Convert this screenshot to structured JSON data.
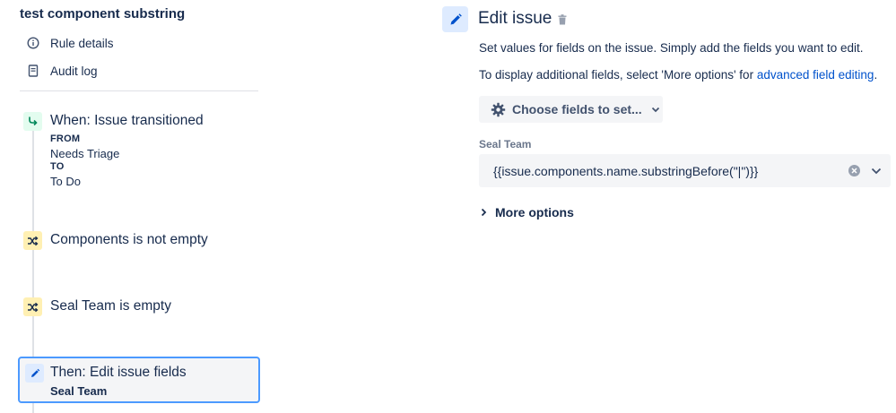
{
  "rule": {
    "title": "test component substring"
  },
  "nav": {
    "items": [
      {
        "label": "Rule details",
        "icon": "info-icon"
      },
      {
        "label": "Audit log",
        "icon": "document-icon"
      }
    ]
  },
  "steps": {
    "trigger": {
      "label": "When: Issue transitioned",
      "from_key": "FROM",
      "from_value": "Needs Triage",
      "to_key": "TO",
      "to_value": "To Do",
      "icon": "transition-icon"
    },
    "condition1": {
      "label": "Components is not empty",
      "icon": "shuffle-icon"
    },
    "condition2": {
      "label": "Seal Team is empty",
      "icon": "shuffle-icon"
    },
    "action": {
      "label": "Then: Edit issue fields",
      "sub": "Seal Team",
      "icon": "pencil-icon"
    }
  },
  "editor": {
    "title": "Edit issue",
    "description1": "Set values for fields on the issue. Simply add the fields you want to edit.",
    "description2_prefix": "To display additional fields, select 'More options' for ",
    "description2_link": "advanced field editing",
    "description2_suffix": ".",
    "choose_fields_label": "Choose fields to set...",
    "field": {
      "label": "Seal Team",
      "value": "{{issue.components.name.substringBefore(\"|\")}}"
    },
    "more_options_label": "More options"
  },
  "colors": {
    "accent": "#0052cc",
    "trigger_badge": "#e3fcef",
    "condition_badge": "#fff0b3",
    "action_badge": "#deebff",
    "selected_border": "#4c9aff"
  }
}
